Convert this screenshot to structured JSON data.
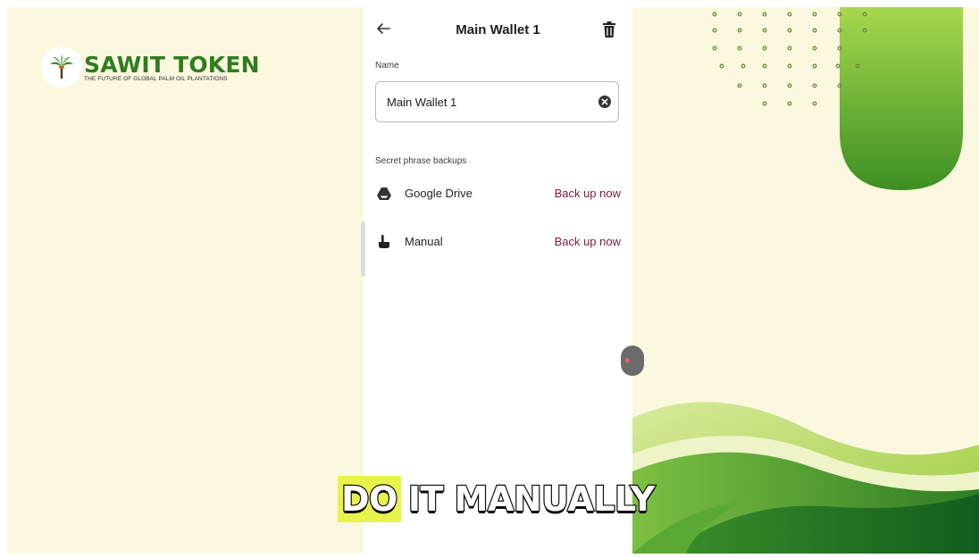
{
  "brand": {
    "title": "SAWIT TOKEN",
    "tagline": "THE FUTURE OF GLOBAL PALM OIL PLANTATIONS",
    "logo_icon": "palm-tree-icon"
  },
  "app": {
    "title": "Main Wallet 1",
    "back_icon": "back-arrow-icon",
    "delete_icon": "trash-icon"
  },
  "name_section": {
    "label": "Name",
    "value": "Main Wallet 1",
    "clear_icon": "clear-icon"
  },
  "backup_section": {
    "label": "Secret phrase backups",
    "rows": [
      {
        "label": "Google Drive",
        "action": "Back up now",
        "icon": "google-drive-icon"
      },
      {
        "label": "Manual",
        "action": "Back up now",
        "icon": "hand-pointer-icon"
      }
    ]
  },
  "caption": {
    "highlight": "DO",
    "rest": "IT MANUALLY"
  },
  "colors": {
    "background": "#fbf8df",
    "brand_green": "#2f7d1e",
    "action_red": "#7b2035",
    "caption_highlight": "#e9f24a"
  }
}
